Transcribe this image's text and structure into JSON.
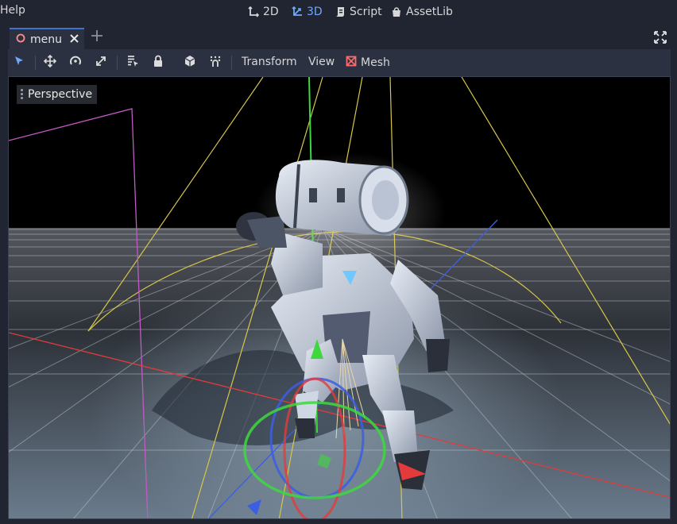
{
  "menubar": {
    "help": "Help"
  },
  "workspaces": [
    {
      "label": "2D",
      "icon": "2d-icon",
      "active": false
    },
    {
      "label": "3D",
      "icon": "3d-icon",
      "active": true
    },
    {
      "label": "Script",
      "icon": "script-icon",
      "active": false
    },
    {
      "label": "AssetLib",
      "icon": "assetlib-icon",
      "active": false
    }
  ],
  "scene_tabs": [
    {
      "label": "menu"
    }
  ],
  "toolbar": {
    "transform_menu": "Transform",
    "view_menu": "View",
    "mesh_menu": "Mesh"
  },
  "viewport": {
    "view_mode": "Perspective"
  },
  "colors": {
    "accent": "#6fa8ff",
    "axis_x": "#e33b3b",
    "axis_y": "#3ed83e",
    "axis_z": "#3b5ee3",
    "tab_scene_icon": "#ff8c8c",
    "mesh_icon": "#ff6b6b"
  }
}
